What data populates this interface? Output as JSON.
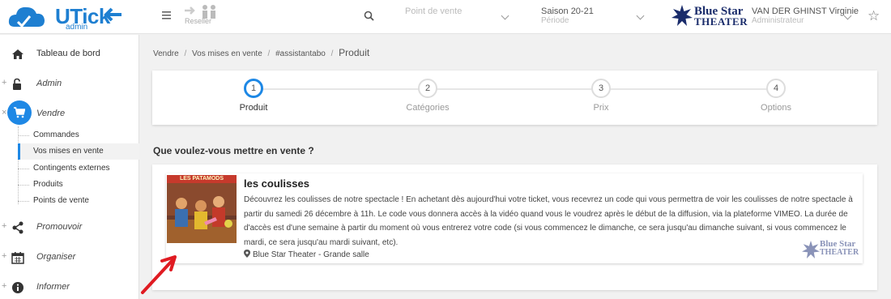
{
  "app": {
    "logo_text": "UTick",
    "logo_sub": "admin",
    "reseller_label": "Reseller",
    "brand_color": "#1e7fd1",
    "accent_color": "#1e88e5"
  },
  "header": {
    "point_de_vente": {
      "value": "Point de vente"
    },
    "saison": {
      "value": "Saison 20-21",
      "sub": "Période"
    },
    "org_logo_line1": "Blue Star",
    "org_logo_line2": "THEATER",
    "user": {
      "name": "VAN DER GHINST Virginie",
      "role": "Administrateur"
    }
  },
  "sidebar": {
    "items": [
      {
        "label": "Tableau de bord",
        "icon": "home-icon"
      },
      {
        "label": "Admin",
        "icon": "unlock-icon"
      },
      {
        "label": "Vendre",
        "icon": "cart-icon"
      },
      {
        "label": "Promouvoir",
        "icon": "share-icon"
      },
      {
        "label": "Organiser",
        "icon": "calendar-icon"
      },
      {
        "label": "Informer",
        "icon": "info-icon"
      }
    ],
    "vendre_sub": [
      {
        "label": "Commandes"
      },
      {
        "label": "Vos mises en vente",
        "active": true
      },
      {
        "label": "Contingents externes"
      },
      {
        "label": "Produits"
      },
      {
        "label": "Points de vente"
      }
    ]
  },
  "breadcrumb": {
    "items": [
      "Vendre",
      "Vos mises en vente",
      "#assistantabo"
    ],
    "current": "Produit"
  },
  "wizard": {
    "steps": [
      {
        "number": "1",
        "label": "Produit",
        "active": true
      },
      {
        "number": "2",
        "label": "Catégories"
      },
      {
        "number": "3",
        "label": "Prix"
      },
      {
        "number": "4",
        "label": "Options"
      }
    ]
  },
  "main": {
    "question": "Que voulez-vous mettre en vente ?",
    "product": {
      "image_banner": "LES PATAMODS",
      "title": "les coulisses",
      "description": " Découvrez les coulisses de notre spectacle ! En achetant dès aujourd'hui votre ticket, vous recevrez un code qui vous permettra de voir les coulisses de notre spectacle à partir du samedi 26 décembre à 11h. Le code vous donnera accès à la vidéo quand vous le voudrez après le début de la diffusion, via la plateforme VIMEO. La durée de d'accès est d'une semaine à partir du moment où vous entrerez votre code (si vous commencez le dimanche, ce sera jusqu'au dimanche suivant, si vous commencez le mardi, ce sera jusqu'au mardi suivant, etc).",
      "venue": "Blue Star Theater - Grande salle",
      "logo_line1": "Blue Star",
      "logo_line2": "THEATER"
    }
  }
}
